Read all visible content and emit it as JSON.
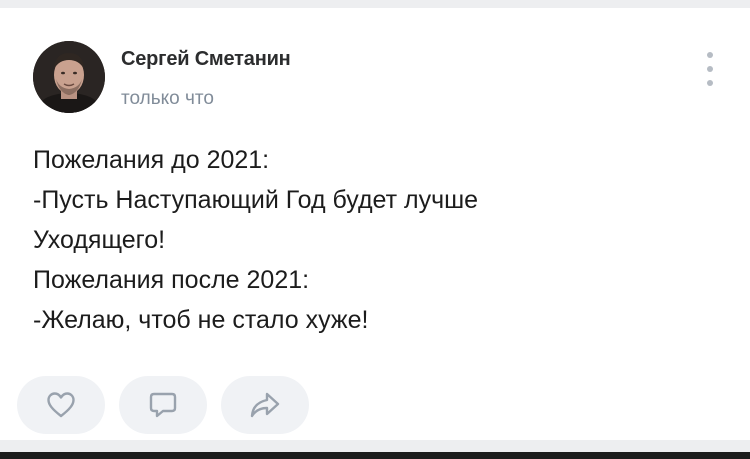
{
  "post": {
    "author": "Сергей Сметанин",
    "time": "только что",
    "lines": [
      "Пожелания до 2021:",
      "-Пусть Наступающий Год будет лучше",
      "Уходящего!",
      "Пожелания после 2021:",
      "-Желаю, чтоб не стало хуже!"
    ]
  },
  "icons": {
    "avatar": "avatar",
    "more": "more-vertical-icon",
    "like": "heart-icon",
    "comment": "comment-icon",
    "share": "share-arrow-icon"
  },
  "colors": {
    "background": "#edeef0",
    "card": "#ffffff",
    "text": "#1c1c1c",
    "secondary_text": "#818c99",
    "icon": "#99a2ad",
    "button_bg": "#f0f2f5"
  }
}
